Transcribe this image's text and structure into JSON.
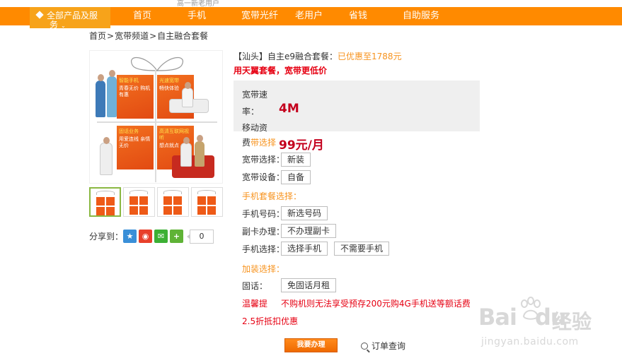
{
  "top_cut_text": "高一新老用户",
  "nav": {
    "category_line1": "全部产品及服",
    "category_line2": "务",
    "items": [
      "首页",
      "手机",
      "宽带光纤",
      "老用户",
      "省钱",
      "自助服务"
    ]
  },
  "breadcrumb": [
    "首页",
    "宽带频道",
    "自主融合套餐"
  ],
  "product_image": {
    "tiles": [
      {
        "title": "智能手机",
        "text": "青春无价 购机有惠"
      },
      {
        "title": "光速宽带",
        "text": "畅快体验"
      },
      {
        "title": "固话业务",
        "text": "用爱连线 亲情无价"
      },
      {
        "title": "高清互联网视听",
        "text": "想点就点"
      }
    ]
  },
  "share": {
    "label": "分享到：",
    "count": "0",
    "icons": [
      "qzone-icon",
      "weibo-icon",
      "wechat-icon",
      "more-icon"
    ]
  },
  "product": {
    "title_prefix": "【汕头】自主e9融合套餐：",
    "title_promo": "已优惠至1788元",
    "slogan": "用天翼套餐，宽带更低价",
    "spec_label_1": "宽带速",
    "spec_label_2": "率：",
    "spec_value": "4M",
    "spec_label_3": "移动资",
    "price_label_a": "费",
    "price_label_b": "带选择",
    "price_value": "99元/月"
  },
  "options": {
    "broadband_choice_label": "宽带选择：",
    "broadband_choice": "新装",
    "broadband_device_label": "宽带设备：",
    "broadband_device": "自备",
    "phone_package_section": "手机套餐选择：",
    "phone_number_label": "手机号码：",
    "phone_number": "新选号码",
    "sub_card_label": "副卡办理：",
    "sub_card": "不办理副卡",
    "phone_choice_label": "手机选择：",
    "phone_choice_a": "选择手机",
    "phone_choice_b": "不需要手机",
    "addon_section": "加装选择：",
    "landline_label": "固话：",
    "landline": "免固话月租"
  },
  "notice": {
    "label": "温馨提",
    "text": "不购机则无法享受预存200元购4G手机送等额话费",
    "text2": "2.5折抵扣优惠"
  },
  "actions": {
    "order_button": "我要办理",
    "order_query": "订单查询"
  },
  "watermark": {
    "brand": "Bai",
    "brand2": "du",
    "cn": "经验",
    "url": "jingyan.baidu.com"
  },
  "colors": {
    "nav_orange": "#ff8a00",
    "promo_orange": "#f7931e",
    "price_red": "#c4001d",
    "alert_red": "#e60012"
  }
}
